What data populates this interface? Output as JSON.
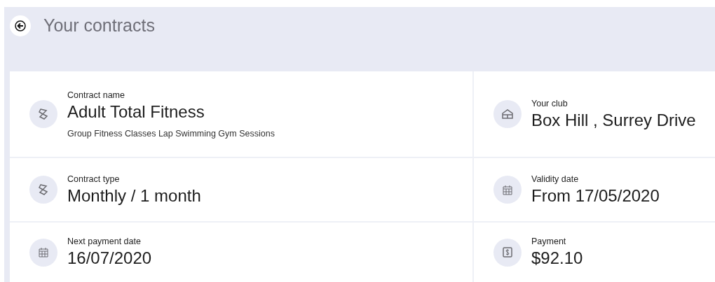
{
  "header": {
    "title": "Your contracts"
  },
  "fields": [
    {
      "kind": "ticket",
      "label": "Contract name",
      "value": "Adult Total Fitness",
      "note": "Group Fitness Classes Lap Swimming Gym Sessions"
    },
    {
      "kind": "club",
      "label": "Your club",
      "value": "Box Hill , Surrey Drive"
    },
    {
      "kind": "ticket",
      "label": "Contract type",
      "value": "Monthly / 1 month"
    },
    {
      "kind": "calendar",
      "label": "Validity date",
      "value": "From 17/05/2020"
    },
    {
      "kind": "calendar",
      "label": "Next payment date",
      "value": "16/07/2020"
    },
    {
      "kind": "dollar",
      "label": "Payment",
      "value": "$92.10"
    }
  ]
}
